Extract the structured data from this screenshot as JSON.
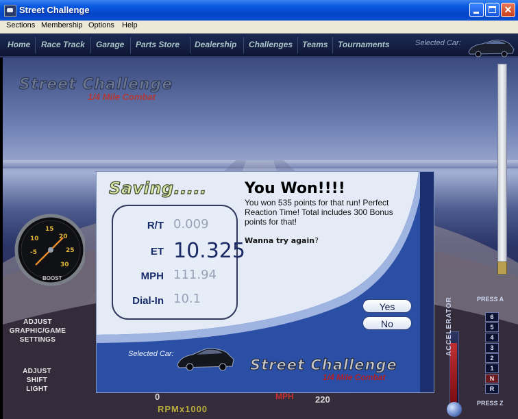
{
  "window": {
    "title": "Street Challenge"
  },
  "menu": [
    "Sections",
    "Membership",
    "Options",
    "Help"
  ],
  "nav": {
    "items": [
      "Home",
      "Race Track",
      "Garage",
      "Parts Store",
      "Dealership",
      "Challenges",
      "Teams",
      "Tournaments"
    ],
    "selected_car_label": "Selected Car:"
  },
  "logo": {
    "main": "Street Challenge",
    "sub": "1/4 Mile Combat"
  },
  "boost_gauge": {
    "ticks": [
      "-5",
      "10",
      "15",
      "20",
      "25",
      "30"
    ],
    "label": "BOOST"
  },
  "side_buttons": {
    "adjust_graphics": [
      "ADJUST",
      "GRAPHIC/GAME",
      "SETTINGS"
    ],
    "adjust_shift": [
      "ADJUST",
      "SHIFT",
      "LIGHT"
    ]
  },
  "gears": {
    "press_a": "PRESS A",
    "press_z": "PRESS Z",
    "list": [
      "6",
      "5",
      "4",
      "3",
      "2",
      "1",
      "N",
      "R"
    ],
    "selected": "N"
  },
  "accelerator": {
    "label": "ACCELERATOR",
    "level": 0.85
  },
  "tachometer": {
    "min_label": "0",
    "unit_label": "RPMx1000"
  },
  "speedometer": {
    "unit_label": "MPH",
    "max_label": "220"
  },
  "dialog": {
    "saving": "Saving.....",
    "stats": {
      "rt": {
        "label": "R/T",
        "value": "0.009"
      },
      "et": {
        "label": "ET",
        "value": "10.325"
      },
      "mph": {
        "label": "MPH",
        "value": "111.94"
      },
      "dialin": {
        "label": "Dial-In",
        "value": "10.1"
      }
    },
    "title": "You Won!!!!",
    "message": "You won 535 points for that run! Perfect Reaction Time! Total includes 300 Bonus points for that!",
    "prompt": "Wanna try again",
    "prompt_mark": "?",
    "yes": "Yes",
    "no": "No",
    "selected_car_label": "Selected Car:",
    "logo_main": "Street Challenge",
    "logo_sub": "1/4 Mile Combat"
  }
}
